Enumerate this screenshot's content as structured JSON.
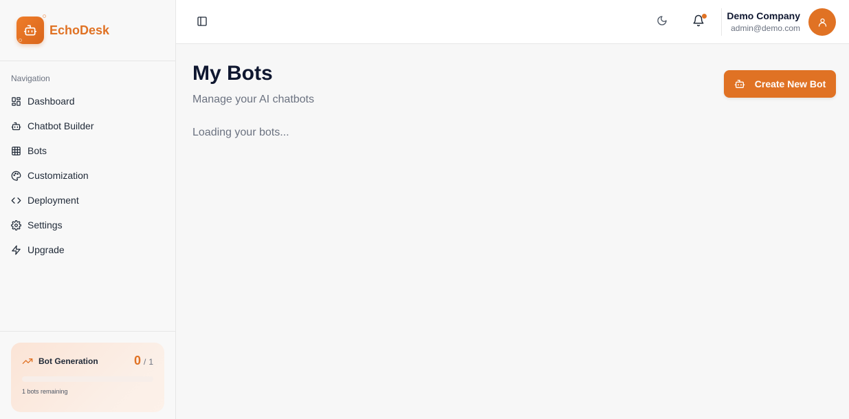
{
  "brand": {
    "name": "EchoDesk",
    "icon": "bot-icon",
    "accent": "#e07224"
  },
  "sidebar": {
    "heading": "Navigation",
    "items": [
      {
        "label": "Dashboard",
        "icon": "dashboard-icon"
      },
      {
        "label": "Chatbot Builder",
        "icon": "bot-icon"
      },
      {
        "label": "Bots",
        "icon": "grid-icon"
      },
      {
        "label": "Customization",
        "icon": "palette-icon"
      },
      {
        "label": "Deployment",
        "icon": "code-icon"
      },
      {
        "label": "Settings",
        "icon": "gear-icon"
      },
      {
        "label": "Upgrade",
        "icon": "lightning-icon"
      }
    ]
  },
  "usage": {
    "title": "Bot Generation",
    "used": "0",
    "separator": "/",
    "limit": "1",
    "progress": 0,
    "remaining_text": "1 bots remaining",
    "icon": "trending-up-icon"
  },
  "header": {
    "sidebar_toggle_icon": "panel-left-icon",
    "theme_icon": "moon-icon",
    "notification_icon": "bell-icon",
    "company": "Demo Company",
    "email": "admin@demo.com",
    "avatar_icon": "user-icon"
  },
  "main": {
    "title": "My Bots",
    "subtitle": "Manage your AI chatbots",
    "loading": "Loading your bots...",
    "create_button": "Create New Bot"
  }
}
